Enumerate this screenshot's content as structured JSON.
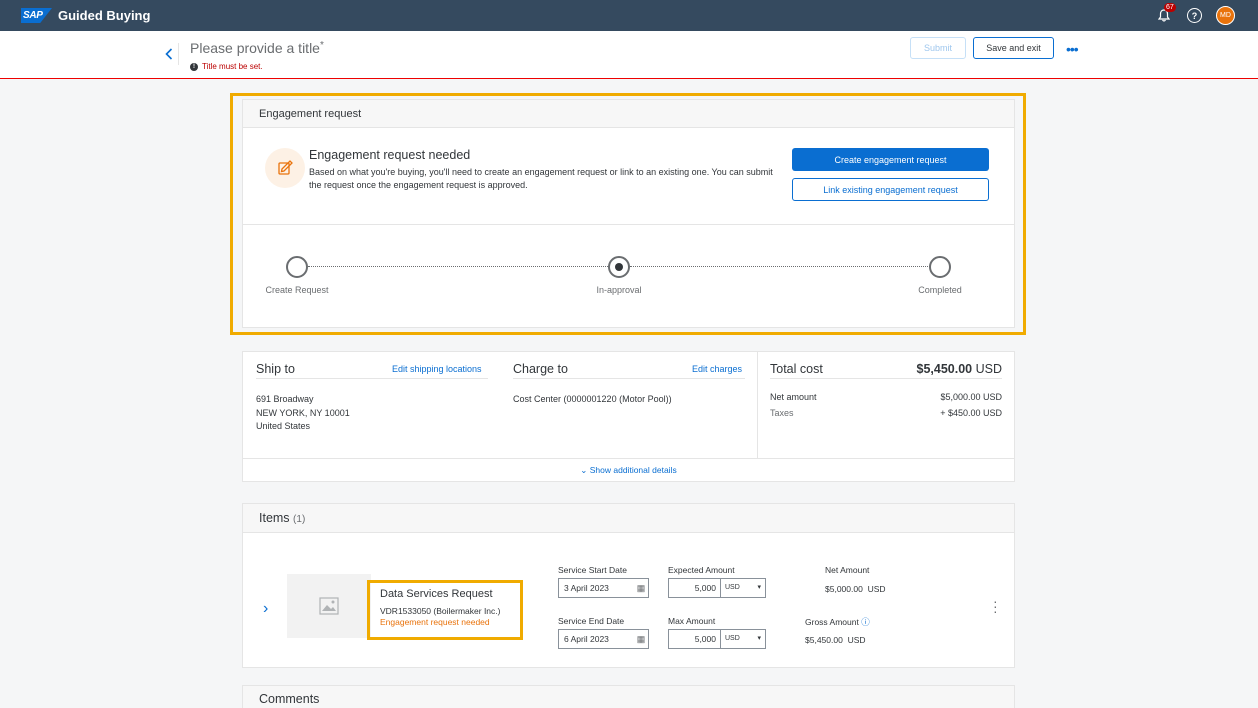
{
  "shell": {
    "logo": "SAP",
    "title": "Guided Buying",
    "notifications": "67",
    "avatar": "MD"
  },
  "header": {
    "title_placeholder": "Please provide a title",
    "required_mark": "*",
    "error": "Title must be set.",
    "submit_label": "Submit",
    "save_exit_label": "Save and exit",
    "more_label": "•••"
  },
  "engagement": {
    "section_title": "Engagement request",
    "title": "Engagement request needed",
    "description": "Based on what you're buying, you'll need to create an engagement request or link to an existing one. You can submit the request once the engagement request is approved.",
    "create_label": "Create engagement request",
    "link_label": "Link existing engagement request",
    "steps": [
      "Create Request",
      "In-approval",
      "Completed"
    ],
    "active_step": 1
  },
  "ship": {
    "ship_title": "Ship to",
    "ship_edit": "Edit shipping locations",
    "address": [
      "691 Broadway",
      "NEW YORK, NY  10001",
      "United States"
    ],
    "charge_title": "Charge to",
    "charge_edit": "Edit charges",
    "charge_value": "Cost Center (0000001220 (Motor Pool))",
    "total_title": "Total cost",
    "total_value": "$5,450.00",
    "total_currency": "USD",
    "net_label": "Net amount",
    "net_value": "$5,000.00 USD",
    "taxes_label": "Taxes",
    "taxes_value": "+ $450.00 USD",
    "show_more": "Show additional details"
  },
  "items": {
    "title": "Items",
    "count": "(1)",
    "item": {
      "name": "Data Services Request",
      "supplier": "VDR1533050 (Boilermaker Inc.)",
      "status": "Engagement request needed",
      "start_label": "Service Start Date",
      "start_value": "3 April 2023",
      "end_label": "Service End Date",
      "end_value": "6 April 2023",
      "expected_label": "Expected Amount",
      "expected_value": "5,000",
      "max_label": "Max Amount",
      "max_value": "5,000",
      "currency": "USD",
      "net_label": "Net Amount",
      "net_value": "$5,000.00",
      "gross_label": "Gross Amount",
      "gross_value": "$5,450.00",
      "value_currency": "USD"
    }
  },
  "comments": {
    "title": "Comments"
  },
  "colors": {
    "shell": "#354a5f",
    "accent": "#0a6ed1",
    "highlight": "#f0ab00",
    "warning": "#e9730c",
    "error": "#bb0000"
  }
}
